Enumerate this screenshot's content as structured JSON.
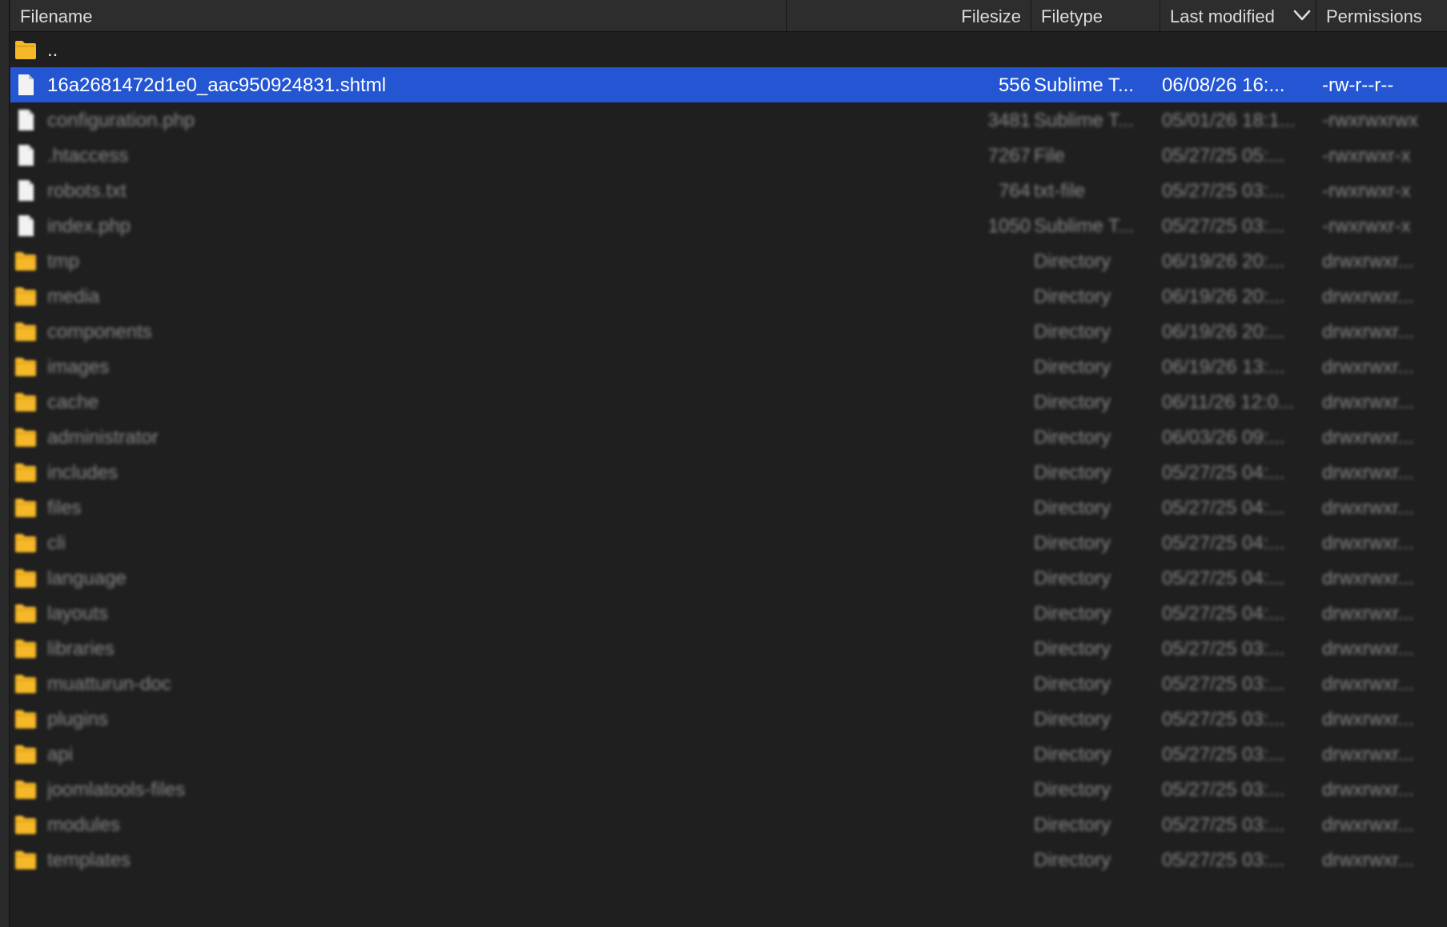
{
  "columns": {
    "filename": "Filename",
    "filesize": "Filesize",
    "filetype": "Filetype",
    "modified": "Last modified",
    "permissions": "Permissions"
  },
  "colors": {
    "selection": "#2456d3",
    "folder": "#f5b829",
    "file": "#f2f2f2",
    "background": "#1f1f1f",
    "header": "#2d2d2d"
  },
  "rows": [
    {
      "icon": "folder-icon",
      "name": "..",
      "size": "",
      "type": "",
      "modified": "",
      "perms": "",
      "state": "clear"
    },
    {
      "icon": "file-icon",
      "name": "16a2681472d1e0_aac950924831.shtml",
      "size": "556",
      "type": "Sublime T...",
      "modified": "06/08/26 16:...",
      "perms": "-rw-r--r--",
      "state": "selected"
    },
    {
      "icon": "file-icon",
      "name": "configuration.php",
      "size": "3481",
      "type": "Sublime T...",
      "modified": "05/01/26 18:1...",
      "perms": "-rwxrwxrwx",
      "state": "blurred"
    },
    {
      "icon": "file-icon",
      "name": ".htaccess",
      "size": "7267",
      "type": "File",
      "modified": "05/27/25 05:...",
      "perms": "-rwxrwxr-x",
      "state": "blurred"
    },
    {
      "icon": "file-icon",
      "name": "robots.txt",
      "size": "764",
      "type": "txt-file",
      "modified": "05/27/25 03:...",
      "perms": "-rwxrwxr-x",
      "state": "blurred"
    },
    {
      "icon": "file-icon",
      "name": "index.php",
      "size": "1050",
      "type": "Sublime T...",
      "modified": "05/27/25 03:...",
      "perms": "-rwxrwxr-x",
      "state": "blurred"
    },
    {
      "icon": "folder-icon",
      "name": "tmp",
      "size": "",
      "type": "Directory",
      "modified": "06/19/26 20:...",
      "perms": "drwxrwxr...",
      "state": "blurred"
    },
    {
      "icon": "folder-icon",
      "name": "media",
      "size": "",
      "type": "Directory",
      "modified": "06/19/26 20:...",
      "perms": "drwxrwxr...",
      "state": "blurred"
    },
    {
      "icon": "folder-icon",
      "name": "components",
      "size": "",
      "type": "Directory",
      "modified": "06/19/26 20:...",
      "perms": "drwxrwxr...",
      "state": "blurred"
    },
    {
      "icon": "folder-icon",
      "name": "images",
      "size": "",
      "type": "Directory",
      "modified": "06/19/26 13:...",
      "perms": "drwxrwxr...",
      "state": "blurred"
    },
    {
      "icon": "folder-icon",
      "name": "cache",
      "size": "",
      "type": "Directory",
      "modified": "06/11/26 12:0...",
      "perms": "drwxrwxr...",
      "state": "blurred"
    },
    {
      "icon": "folder-icon",
      "name": "administrator",
      "size": "",
      "type": "Directory",
      "modified": "06/03/26 09:...",
      "perms": "drwxrwxr...",
      "state": "blurred"
    },
    {
      "icon": "folder-icon",
      "name": "includes",
      "size": "",
      "type": "Directory",
      "modified": "05/27/25 04:...",
      "perms": "drwxrwxr...",
      "state": "blurred"
    },
    {
      "icon": "folder-icon",
      "name": "files",
      "size": "",
      "type": "Directory",
      "modified": "05/27/25 04:...",
      "perms": "drwxrwxr...",
      "state": "blurred"
    },
    {
      "icon": "folder-icon",
      "name": "cli",
      "size": "",
      "type": "Directory",
      "modified": "05/27/25 04:...",
      "perms": "drwxrwxr...",
      "state": "blurred"
    },
    {
      "icon": "folder-icon",
      "name": "language",
      "size": "",
      "type": "Directory",
      "modified": "05/27/25 04:...",
      "perms": "drwxrwxr...",
      "state": "blurred"
    },
    {
      "icon": "folder-icon",
      "name": "layouts",
      "size": "",
      "type": "Directory",
      "modified": "05/27/25 04:...",
      "perms": "drwxrwxr...",
      "state": "blurred"
    },
    {
      "icon": "folder-icon",
      "name": "libraries",
      "size": "",
      "type": "Directory",
      "modified": "05/27/25 03:...",
      "perms": "drwxrwxr...",
      "state": "blurred"
    },
    {
      "icon": "folder-icon",
      "name": "muatturun-doc",
      "size": "",
      "type": "Directory",
      "modified": "05/27/25 03:...",
      "perms": "drwxrwxr...",
      "state": "blurred"
    },
    {
      "icon": "folder-icon",
      "name": "plugins",
      "size": "",
      "type": "Directory",
      "modified": "05/27/25 03:...",
      "perms": "drwxrwxr...",
      "state": "blurred"
    },
    {
      "icon": "folder-icon",
      "name": "api",
      "size": "",
      "type": "Directory",
      "modified": "05/27/25 03:...",
      "perms": "drwxrwxr...",
      "state": "blurred"
    },
    {
      "icon": "folder-icon",
      "name": "joomlatools-files",
      "size": "",
      "type": "Directory",
      "modified": "05/27/25 03:...",
      "perms": "drwxrwxr...",
      "state": "blurred"
    },
    {
      "icon": "folder-icon",
      "name": "modules",
      "size": "",
      "type": "Directory",
      "modified": "05/27/25 03:...",
      "perms": "drwxrwxr...",
      "state": "blurred"
    },
    {
      "icon": "folder-icon",
      "name": "templates",
      "size": "",
      "type": "Directory",
      "modified": "05/27/25 03:...",
      "perms": "drwxrwxr...",
      "state": "blurred"
    }
  ]
}
